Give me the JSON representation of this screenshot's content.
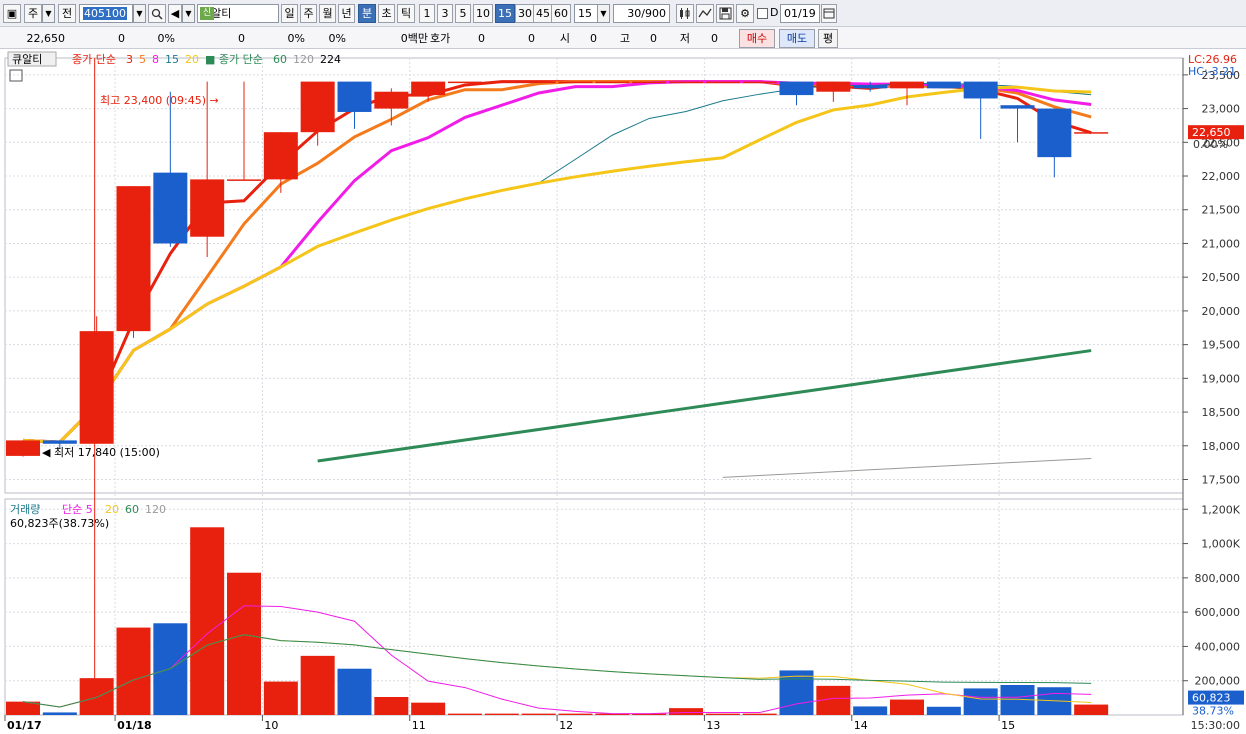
{
  "toolbar": {
    "market": "주",
    "scope": "전",
    "code": "405100",
    "stock_name": "큐알티",
    "badge": "신",
    "periods": [
      "일",
      "주",
      "월",
      "년",
      "분",
      "초",
      "틱"
    ],
    "selected_period": "분",
    "intervals": [
      "1",
      "3",
      "5",
      "10",
      "15",
      "30",
      "45",
      "60"
    ],
    "selected_interval": "15",
    "interval_value": "15",
    "count": "30/900",
    "checkbox_label": "D",
    "date": "01/19"
  },
  "quote": {
    "price": "22,650",
    "change": "0",
    "change_pct": "0%",
    "volume": "0",
    "volume_pct": "0%",
    "amount_pct": "0%",
    "amount": "0백만",
    "hoga_label": "호가",
    "hoga_a": "0",
    "hoga_b": "0",
    "open_label": "시",
    "open": "0",
    "high_label": "고",
    "high": "0",
    "low_label": "저",
    "low": "0",
    "buy": "매수",
    "sell": "매도",
    "avg": "평"
  },
  "colors": {
    "up": "#e8210e",
    "down": "#1a5fcc",
    "ma3": "#e8210e",
    "ma5": "#f47a1c",
    "ma8": "#f21ce8",
    "ma15": "#1a7a8c",
    "ma20": "#f5c518",
    "ma60": "#2e8b57",
    "ma120": "#999999",
    "ma224": "#000000"
  },
  "chart_data": [
    {
      "type": "candlestick",
      "legend": {
        "name": "큐알티",
        "label": "종가 단순",
        "periods": [
          "3",
          "5",
          "8",
          "15",
          "20"
        ],
        "label2": "종가 단순",
        "periods2": [
          "60",
          "120",
          "224"
        ]
      },
      "lc": "LC:26.96",
      "hc": "HC:-3.21",
      "price_tag": "22,650",
      "zero_pct": "0.00%",
      "annotation_high": "최고 23,400 (09:45)",
      "annotation_low": "최저 17,840 (15:00)",
      "ylim": [
        17300,
        23750
      ],
      "y_ticks": [
        "23,500",
        "23,000",
        "22,500",
        "22,000",
        "21,500",
        "21,000",
        "20,500",
        "20,000",
        "19,500",
        "19,000",
        "18,500",
        "18,000",
        "17,500"
      ],
      "candles": [
        {
          "o": 17850,
          "h": 18080,
          "l": 17840,
          "c": 18080
        },
        {
          "o": 18080,
          "h": 18080,
          "l": 17960,
          "c": 18030
        },
        {
          "o": 18030,
          "h": 19920,
          "l": 18030,
          "c": 19700
        },
        {
          "o": 19700,
          "h": 21850,
          "l": 19600,
          "c": 21850
        },
        {
          "o": 22050,
          "h": 23250,
          "l": 20950,
          "c": 21000
        },
        {
          "o": 21100,
          "h": 23400,
          "l": 20800,
          "c": 21950
        },
        {
          "o": 21950,
          "h": 23400,
          "l": 21950,
          "c": 21950
        },
        {
          "o": 21950,
          "h": 22650,
          "l": 21750,
          "c": 22650
        },
        {
          "o": 22650,
          "h": 23400,
          "l": 22450,
          "c": 23400
        },
        {
          "o": 23400,
          "h": 23400,
          "l": 22700,
          "c": 22950
        },
        {
          "o": 23000,
          "h": 23300,
          "l": 22750,
          "c": 23250
        },
        {
          "o": 23200,
          "h": 23400,
          "l": 23100,
          "c": 23400
        },
        {
          "o": 23400,
          "h": 23400,
          "l": 23400,
          "c": 23400
        },
        {
          "o": 23400,
          "h": 23400,
          "l": 23400,
          "c": 23400
        },
        {
          "o": 23400,
          "h": 23400,
          "l": 23400,
          "c": 23400
        },
        {
          "o": 23400,
          "h": 23400,
          "l": 23400,
          "c": 23400
        },
        {
          "o": 23400,
          "h": 23400,
          "l": 23400,
          "c": 23400
        },
        {
          "o": 23400,
          "h": 23400,
          "l": 23400,
          "c": 23400
        },
        {
          "o": 23400,
          "h": 23400,
          "l": 23400,
          "c": 23400
        },
        {
          "o": 23400,
          "h": 23400,
          "l": 23400,
          "c": 23400
        },
        {
          "o": 23400,
          "h": 23400,
          "l": 23400,
          "c": 23400
        },
        {
          "o": 23400,
          "h": 23400,
          "l": 23050,
          "c": 23200
        },
        {
          "o": 23250,
          "h": 23400,
          "l": 23100,
          "c": 23400
        },
        {
          "o": 23350,
          "h": 23400,
          "l": 23250,
          "c": 23300
        },
        {
          "o": 23300,
          "h": 23400,
          "l": 23050,
          "c": 23400
        },
        {
          "o": 23400,
          "h": 23400,
          "l": 23300,
          "c": 23300
        },
        {
          "o": 23400,
          "h": 23400,
          "l": 22550,
          "c": 23150
        },
        {
          "o": 23050,
          "h": 23050,
          "l": 22500,
          "c": 23000
        },
        {
          "o": 23000,
          "h": 23000,
          "l": 21980,
          "c": 22280
        },
        {
          "o": 22650,
          "h": 22650,
          "l": 22650,
          "c": 22650
        }
      ]
    },
    {
      "type": "bar",
      "legend": {
        "name": "거래량",
        "label": "단순",
        "periods": [
          "5",
          "20",
          "60",
          "120"
        ]
      },
      "current": "60,823주(38.73%)",
      "volume_tag": "60,823",
      "volume_pct_tag": "38.73%",
      "ylim": [
        0,
        1260000
      ],
      "y_ticks": [
        "1,200K",
        "1,000K",
        "800,000",
        "600,000",
        "400,000",
        "200,000"
      ],
      "values": [
        78000,
        15000,
        215000,
        510000,
        535000,
        1095000,
        830000,
        195000,
        345000,
        270000,
        105000,
        72000,
        8000,
        8000,
        8000,
        8000,
        8000,
        8000,
        40000,
        8000,
        8000,
        260000,
        170000,
        50000,
        90000,
        48000,
        155000,
        175000,
        162000,
        60823
      ],
      "x_labels": [
        "01/17",
        "01/18",
        "10",
        "11",
        "12",
        "13",
        "14",
        "15",
        "15:30:00"
      ]
    }
  ]
}
